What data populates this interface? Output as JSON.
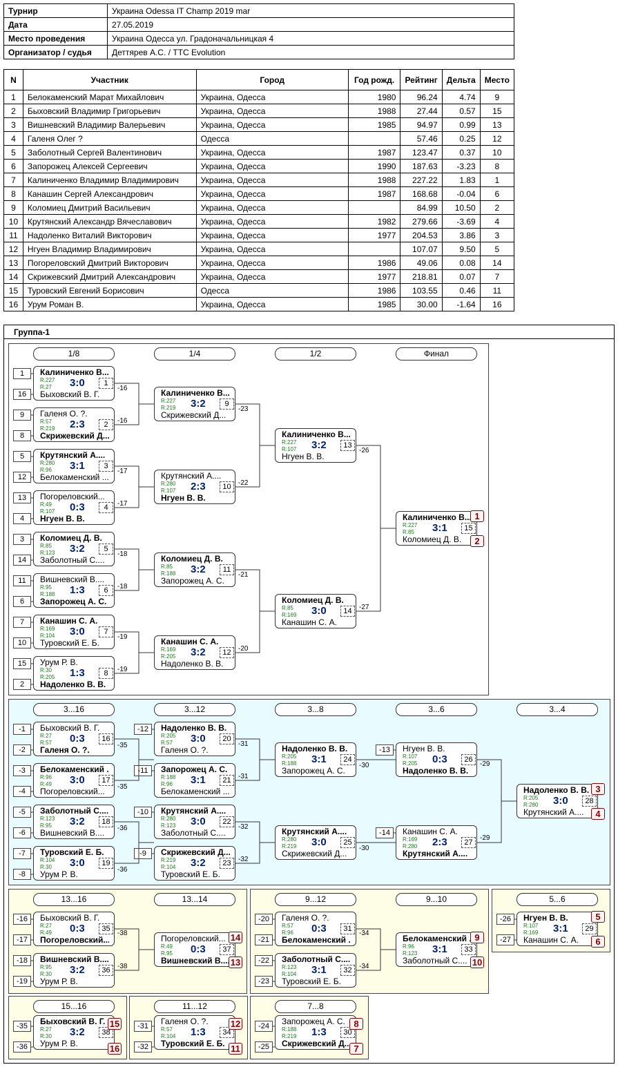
{
  "info": [
    {
      "label": "Турнир",
      "value": "Украина Odessa IT Champ 2019 mar"
    },
    {
      "label": "Дата",
      "value": "27.05.2019"
    },
    {
      "label": "Место проведения",
      "value": "Украина Одесса ул. Градоначальницкая 4"
    },
    {
      "label": "Организатор / судья",
      "value": "Деттярев А.С. / TTC Evolution"
    }
  ],
  "players": {
    "headers": [
      "N",
      "Участник",
      "Город",
      "Год рожд.",
      "Рейтинг",
      "Дельта",
      "Место"
    ],
    "rows": [
      [
        "1",
        "Белокаменский Марат Михайлович",
        "Украина, Одесса",
        "1980",
        "96.24",
        "4.74",
        "9"
      ],
      [
        "2",
        "Быховский Владимир Григорьевич",
        "Украина, Одесса",
        "1988",
        "27.44",
        "0.57",
        "15"
      ],
      [
        "3",
        "Вишневский Владимир Валерьевич",
        "Украина, Одесса",
        "1985",
        "94.97",
        "0.99",
        "13"
      ],
      [
        "4",
        "Галеня Олег ?",
        "Одесса",
        "",
        "57.46",
        "0.25",
        "12"
      ],
      [
        "5",
        "Заболотный Сергей Валентинович",
        "Украина, Одесса",
        "1987",
        "123.47",
        "0.37",
        "10"
      ],
      [
        "6",
        "Запорожец Алексей Сергеевич",
        "Украина, Одесса",
        "1990",
        "187.63",
        "-3.23",
        "8"
      ],
      [
        "7",
        "Калиниченко Владимир Владимирович",
        "Украина, Одесса",
        "1988",
        "227.22",
        "1.83",
        "1"
      ],
      [
        "8",
        "Канашин Сергей Александрович",
        "Украина, Одесса",
        "1987",
        "168.68",
        "-0.04",
        "6"
      ],
      [
        "9",
        "Коломиец Дмитрий Васильевич",
        "Украина, Одесса",
        "",
        "84.99",
        "10.50",
        "2"
      ],
      [
        "10",
        "Крутянский Александр Вячеславович",
        "Украина, Одесса",
        "1982",
        "279.66",
        "-3.69",
        "4"
      ],
      [
        "11",
        "Надоленко Виталий Викторович",
        "Украина, Одесса",
        "1977",
        "204.53",
        "3.86",
        "3"
      ],
      [
        "12",
        "Нгуен Владимир Владимирович",
        "Украина, Одесса",
        "",
        "107.07",
        "9.50",
        "5"
      ],
      [
        "13",
        "Погореловский Дмитрий Викторович",
        "Украина, Одесса",
        "1986",
        "49.06",
        "0.08",
        "14"
      ],
      [
        "14",
        "Скрижевский Дмитрий Александрович",
        "Украина, Одесса",
        "1977",
        "218.81",
        "0.07",
        "7"
      ],
      [
        "15",
        "Туровский Евгений Борисович",
        "Одесса",
        "1986",
        "103.55",
        "0.46",
        "11"
      ],
      [
        "16",
        "Урум Роман В.",
        "Украина, Одесса",
        "1985",
        "30.00",
        "-1.64",
        "16"
      ]
    ]
  },
  "group": {
    "title": "Группа-1"
  },
  "rounds": [
    "1/8",
    "1/4",
    "1/2",
    "Финал",
    "3...16",
    "3...12",
    "3...8",
    "3...6",
    "3...4",
    "13...16",
    "13...14",
    "9...12",
    "9...10",
    "5...6",
    "15...16",
    "11...12",
    "7...8"
  ],
  "seeds": [
    "1",
    "16",
    "9",
    "8",
    "5",
    "12",
    "13",
    "4",
    "3",
    "14",
    "11",
    "6",
    "7",
    "10",
    "15",
    "2",
    "-1",
    "-2",
    "-3",
    "-4",
    "-5",
    "-6",
    "-7",
    "-8",
    "-12",
    "-11",
    "-10",
    "-9",
    "-13",
    "-14",
    "-16",
    "-17",
    "-18",
    "-19",
    "-20",
    "-21",
    "-22",
    "-23",
    "-26",
    "-27",
    "-35",
    "-36",
    "-31",
    "-32",
    "-24",
    "-25"
  ],
  "refs": [
    "-16",
    "-16",
    "-17",
    "-17",
    "-18",
    "-18",
    "-19",
    "-19",
    "-23",
    "-22",
    "-21",
    "-20",
    "-26",
    "-27",
    "-35",
    "-35",
    "-36",
    "-36",
    "-31",
    "-31",
    "-32",
    "-32",
    "-30",
    "-30",
    "-29",
    "-29",
    "-38",
    "-38",
    "-34",
    "-34"
  ],
  "matches": [
    {
      "top": "Калиниченко В...",
      "top_r": "R:227",
      "bot": "Быховский В. Г.",
      "bot_r": "R:27",
      "score": "3:0",
      "num": "1",
      "win": "top"
    },
    {
      "top": "Галеня О. ?.",
      "top_r": "R:57",
      "bot": "Скрижевский Д...",
      "bot_r": "R:219",
      "score": "2:3",
      "num": "2",
      "win": "bot"
    },
    {
      "top": "Крутянский А....",
      "top_r": "R:280",
      "bot": "Белокаменский ...",
      "bot_r": "R:96",
      "score": "3:1",
      "num": "3",
      "win": "top"
    },
    {
      "top": "Погореловский...",
      "top_r": "R:49",
      "bot": "Нгуен В. В.",
      "bot_r": "R:107",
      "score": "0:3",
      "num": "4",
      "win": "bot"
    },
    {
      "top": "Коломиец Д. В.",
      "top_r": "R:85",
      "bot": "Заболотный С....",
      "bot_r": "R:123",
      "score": "3:2",
      "num": "5",
      "win": "top"
    },
    {
      "top": "Вишневский В....",
      "top_r": "R:95",
      "bot": "Запорожец А. С.",
      "bot_r": "R:188",
      "score": "1:3",
      "num": "6",
      "win": "bot"
    },
    {
      "top": "Канашин С. А.",
      "top_r": "R:169",
      "bot": "Туровский Е. Б.",
      "bot_r": "R:104",
      "score": "3:0",
      "num": "7",
      "win": "top"
    },
    {
      "top": "Урум Р. В.",
      "top_r": "R:30",
      "bot": "Надоленко В. В.",
      "bot_r": "R:205",
      "score": "1:3",
      "num": "8",
      "win": "bot"
    },
    {
      "top": "Калиниченко В...",
      "top_r": "R:227",
      "bot": "Скрижевский Д...",
      "bot_r": "R:219",
      "score": "3:2",
      "num": "9",
      "win": "top"
    },
    {
      "top": "Крутянский А....",
      "top_r": "R:280",
      "bot": "Нгуен В. В.",
      "bot_r": "R:107",
      "score": "2:3",
      "num": "10",
      "win": "bot"
    },
    {
      "top": "Коломиец Д. В.",
      "top_r": "R:85",
      "bot": "Запорожец А. С.",
      "bot_r": "R:188",
      "score": "3:2",
      "num": "11",
      "win": "top"
    },
    {
      "top": "Канашин С. А.",
      "top_r": "R:169",
      "bot": "Надоленко В. В.",
      "bot_r": "R:205",
      "score": "3:2",
      "num": "12",
      "win": "top"
    },
    {
      "top": "Калиниченко В...",
      "top_r": "R:227",
      "bot": "Нгуен В. В.",
      "bot_r": "R:107",
      "score": "3:2",
      "num": "13",
      "win": "top"
    },
    {
      "top": "Коломиец Д. В.",
      "top_r": "R:85",
      "bot": "Канашин С. А.",
      "bot_r": "R:169",
      "score": "3:0",
      "num": "14",
      "win": "top"
    },
    {
      "top": "Калиниченко В...",
      "top_r": "R:227",
      "bot": "Коломиец Д. В.",
      "bot_r": "R:85",
      "score": "3:1",
      "num": "15",
      "win": "top"
    },
    {
      "top": "Быховский В. Г.",
      "top_r": "R:27",
      "bot": "Галеня О. ?.",
      "bot_r": "R:57",
      "score": "0:3",
      "num": "16",
      "win": "bot"
    },
    {
      "top": "Белокаменский ...",
      "top_r": "R:96",
      "bot": "Погореловский...",
      "bot_r": "R:49",
      "score": "3:0",
      "num": "17",
      "win": "top"
    },
    {
      "top": "Заболотный С....",
      "top_r": "R:123",
      "bot": "Вишневский В....",
      "bot_r": "R:95",
      "score": "3:2",
      "num": "18",
      "win": "top"
    },
    {
      "top": "Туровский Е. Б.",
      "top_r": "R:104",
      "bot": "Урум Р. В.",
      "bot_r": "R:30",
      "score": "3:0",
      "num": "19",
      "win": "top"
    },
    {
      "top": "Надоленко В. В.",
      "top_r": "R:205",
      "bot": "Галеня О. ?.",
      "bot_r": "R:57",
      "score": "3:0",
      "num": "20",
      "win": "top"
    },
    {
      "top": "Запорожец А. С.",
      "top_r": "R:188",
      "bot": "Белокаменский ...",
      "bot_r": "R:96",
      "score": "3:1",
      "num": "21",
      "win": "top"
    },
    {
      "top": "Крутянский А....",
      "top_r": "R:280",
      "bot": "Заболотный С....",
      "bot_r": "R:123",
      "score": "3:0",
      "num": "22",
      "win": "top"
    },
    {
      "top": "Скрижевский Д...",
      "top_r": "R:219",
      "bot": "Туровский Е. Б.",
      "bot_r": "R:104",
      "score": "3:2",
      "num": "23",
      "win": "top"
    },
    {
      "top": "Надоленко В. В.",
      "top_r": "R:205",
      "bot": "Запорожец А. С.",
      "bot_r": "R:188",
      "score": "3:1",
      "num": "24",
      "win": "top"
    },
    {
      "top": "Крутянский А....",
      "top_r": "R:280",
      "bot": "Скрижевский Д...",
      "bot_r": "R:219",
      "score": "3:0",
      "num": "25",
      "win": "top"
    },
    {
      "top": "Нгуен В. В.",
      "top_r": "R:107",
      "bot": "Надоленко В. В.",
      "bot_r": "R:205",
      "score": "0:3",
      "num": "26",
      "win": "bot"
    },
    {
      "top": "Канашин С. А.",
      "top_r": "R:169",
      "bot": "Крутянский А....",
      "bot_r": "R:280",
      "score": "2:3",
      "num": "27",
      "win": "bot"
    },
    {
      "top": "Надоленко В. В.",
      "top_r": "R:205",
      "bot": "Крутянский А....",
      "bot_r": "R:280",
      "score": "3:0",
      "num": "28",
      "win": "top"
    },
    {
      "top": "Нгуен В. В.",
      "top_r": "R:107",
      "bot": "Канашин С. А.",
      "bot_r": "R:169",
      "score": "3:1",
      "num": "29",
      "win": "top"
    },
    {
      "top": "Запорожец А. С.",
      "top_r": "R:188",
      "bot": "Скрижевский Д...",
      "bot_r": "R:219",
      "score": "1:3",
      "num": "30",
      "win": "bot"
    },
    {
      "top": "Галеня О. ?.",
      "top_r": "R:57",
      "bot": "Белокаменский ...",
      "bot_r": "R:96",
      "score": "0:3",
      "num": "31",
      "win": "bot"
    },
    {
      "top": "Заболотный С....",
      "top_r": "R:123",
      "bot": "Туровский Е. Б.",
      "bot_r": "R:104",
      "score": "3:1",
      "num": "32",
      "win": "top"
    },
    {
      "top": "Белокаменский ...",
      "top_r": "R:96",
      "bot": "Заболотный С....",
      "bot_r": "R:123",
      "score": "3:1",
      "num": "33",
      "win": "top"
    },
    {
      "top": "Галеня О. ?.",
      "top_r": "R:57",
      "bot": "Туровский Е. Б.",
      "bot_r": "R:104",
      "score": "1:3",
      "num": "34",
      "win": "bot"
    },
    {
      "top": "Быховский В. Г.",
      "top_r": "R:27",
      "bot": "Погореловский...",
      "bot_r": "R:49",
      "score": "0:3",
      "num": "35",
      "win": "bot"
    },
    {
      "top": "Вишневский В....",
      "top_r": "R:95",
      "bot": "Урум Р. В.",
      "bot_r": "R:30",
      "score": "3:2",
      "num": "36",
      "win": "top"
    },
    {
      "top": "Погореловский...",
      "top_r": "R:49",
      "bot": "Вишневский В....",
      "bot_r": "R:95",
      "score": "0:3",
      "num": "37",
      "win": "bot"
    },
    {
      "top": "Быховский В. Г.",
      "top_r": "R:27",
      "bot": "Урум Р. В.",
      "bot_r": "R:30",
      "score": "3:2",
      "num": "38",
      "win": "top"
    }
  ],
  "places": [
    "1",
    "2",
    "3",
    "4",
    "5",
    "6",
    "9",
    "10",
    "14",
    "13",
    "15",
    "16",
    "12",
    "11",
    "8",
    "7"
  ]
}
